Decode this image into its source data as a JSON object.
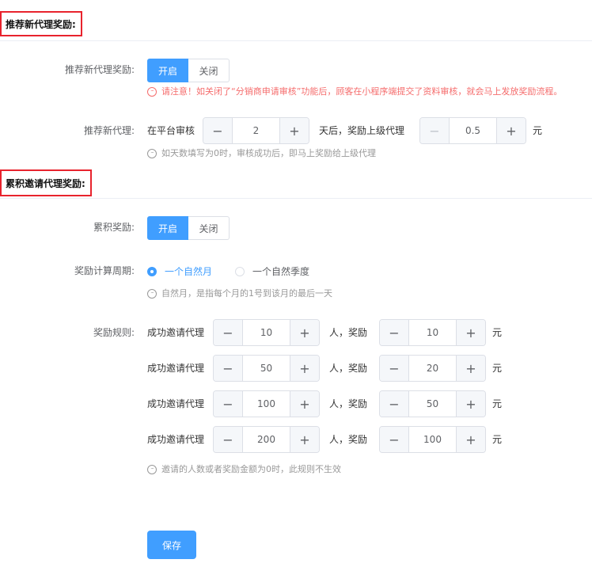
{
  "section1": {
    "title": "推荐新代理奖励:",
    "toggle_label": "推荐新代理奖励:",
    "toggle_on": "开启",
    "toggle_off": "关闭",
    "warning": "请注意！如关闭了“分销商申请审核”功能后，顾客在小程序端提交了资料审核，就会马上发放奖励流程。",
    "agent_label": "推荐新代理:",
    "prefix": "在平台审核",
    "days_value": "2",
    "middle": "天后，奖励上级代理",
    "reward_value": "0.5",
    "unit": "元",
    "days_note": "如天数填写为0时，审核成功后，即马上奖励给上级代理"
  },
  "section2": {
    "title": "累积邀请代理奖励:",
    "toggle_label": "累积奖励:",
    "toggle_on": "开启",
    "toggle_off": "关闭",
    "period_label": "奖励计算周期:",
    "period_option1": "一个自然月",
    "period_option2": "一个自然季度",
    "period_note": "自然月，是指每个月的1号到该月的最后一天",
    "rules_label": "奖励规则:",
    "rules": [
      {
        "prefix": "成功邀请代理",
        "count": "10",
        "middle": "人，奖励",
        "reward": "10",
        "unit": "元"
      },
      {
        "prefix": "成功邀请代理",
        "count": "50",
        "middle": "人，奖励",
        "reward": "20",
        "unit": "元"
      },
      {
        "prefix": "成功邀请代理",
        "count": "100",
        "middle": "人，奖励",
        "reward": "50",
        "unit": "元"
      },
      {
        "prefix": "成功邀请代理",
        "count": "200",
        "middle": "人，奖励",
        "reward": "100",
        "unit": "元"
      }
    ],
    "rules_note": "邀请的人数或者奖励金额为0时，此规则不生效"
  },
  "icons": {
    "minus": "minus-icon",
    "plus": "plus-icon",
    "info": "info-icon"
  },
  "colors": {
    "primary": "#409eff",
    "warning": "#f56c6c",
    "highlight_border": "#e8232d"
  },
  "save_label": "保存"
}
